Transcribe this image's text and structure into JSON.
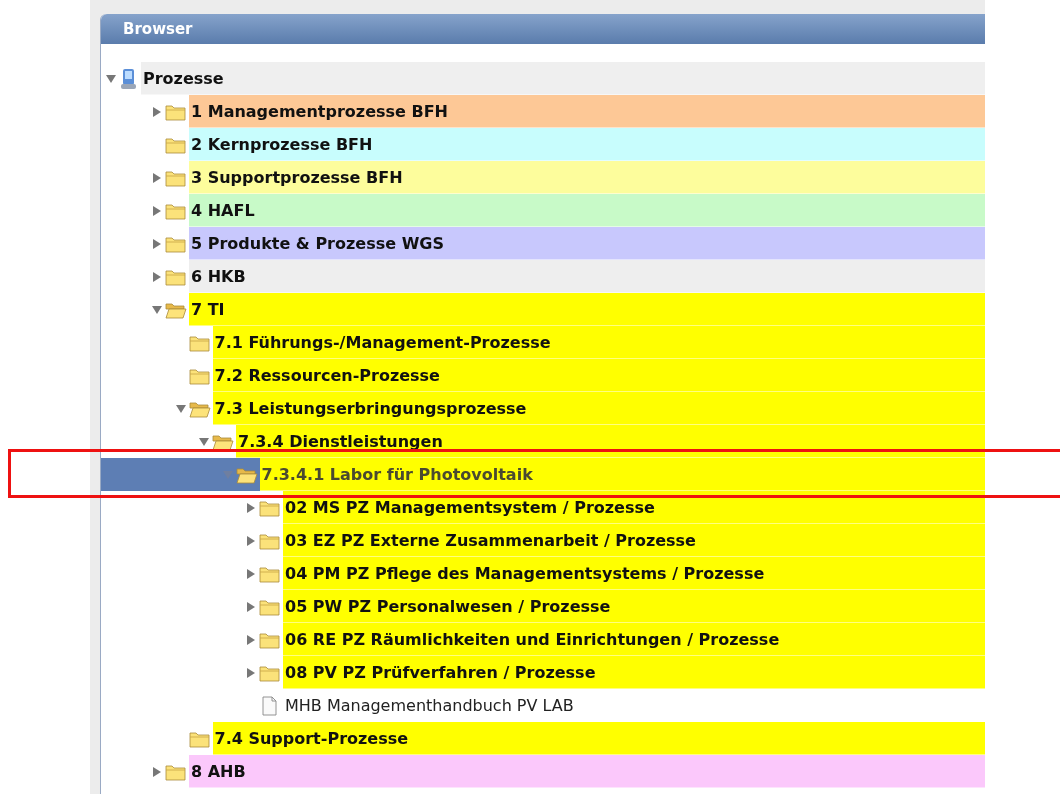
{
  "panel": {
    "title": "Browser"
  },
  "tree": [
    {
      "label": "Prozesse",
      "kind": "root",
      "expanded": true,
      "selected": false,
      "color": "#efefef",
      "children": [
        {
          "label": "1 Managementprozesse BFH",
          "kind": "folder",
          "expanded": false,
          "selected": false,
          "color": "#fdc896"
        },
        {
          "label": "2 Kernprozesse BFH",
          "kind": "folder",
          "selected": false,
          "color": "#c8fdfd"
        },
        {
          "label": "3 Supportprozesse BFH",
          "kind": "folder",
          "expanded": false,
          "selected": false,
          "color": "#fdfd9c"
        },
        {
          "label": "4 HAFL",
          "kind": "folder",
          "expanded": false,
          "selected": false,
          "color": "#c8fac8"
        },
        {
          "label": "5 Produkte & Prozesse WGS",
          "kind": "folder",
          "expanded": false,
          "selected": false,
          "color": "#c8c8fd"
        },
        {
          "label": "6 HKB",
          "kind": "folder",
          "expanded": false,
          "selected": false,
          "color": "#eeeeee"
        },
        {
          "label": "7 TI",
          "kind": "folder",
          "expanded": true,
          "selected": false,
          "color": "#ffff00",
          "children": [
            {
              "label": "7.1 Führungs-/Management-Prozesse",
              "kind": "folder",
              "selected": false,
              "color": "#ffff00"
            },
            {
              "label": "7.2 Ressourcen-Prozesse",
              "kind": "folder",
              "selected": false,
              "color": "#ffff00"
            },
            {
              "label": "7.3 Leistungserbringungsprozesse",
              "kind": "folder",
              "expanded": true,
              "selected": false,
              "color": "#ffff00",
              "children": [
                {
                  "label": "7.3.4 Dienstleistungen",
                  "kind": "folder",
                  "expanded": true,
                  "selected": false,
                  "color": "#ffff00",
                  "children": [
                    {
                      "label": "7.3.4.1 Labor für Photovoltaik",
                      "kind": "folder",
                      "expanded": true,
                      "selected": true,
                      "color": "#ffff00",
                      "children": [
                        {
                          "label": "02 MS PZ Managementsystem / Prozesse",
                          "kind": "folder",
                          "expanded": false,
                          "selected": false,
                          "color": "#ffff00"
                        },
                        {
                          "label": "03 EZ PZ Externe Zusammenarbeit / Prozesse",
                          "kind": "folder",
                          "expanded": false,
                          "selected": false,
                          "color": "#ffff00"
                        },
                        {
                          "label": "04 PM PZ Pflege des Managementsystems / Prozesse",
                          "kind": "folder",
                          "expanded": false,
                          "selected": false,
                          "color": "#ffff00"
                        },
                        {
                          "label": "05 PW PZ Personalwesen / Prozesse",
                          "kind": "folder",
                          "expanded": false,
                          "selected": false,
                          "color": "#ffff00"
                        },
                        {
                          "label": "06 RE PZ Räumlichkeiten und Einrichtungen / Prozesse",
                          "kind": "folder",
                          "expanded": false,
                          "selected": false,
                          "color": "#ffff00"
                        },
                        {
                          "label": "08 PV PZ Prüfverfahren / Prozesse",
                          "kind": "folder",
                          "expanded": false,
                          "selected": false,
                          "color": "#ffff00"
                        },
                        {
                          "label": "MHB Managementhandbuch PV LAB",
                          "kind": "file",
                          "selected": false
                        }
                      ]
                    }
                  ]
                }
              ]
            },
            {
              "label": "7.4 Support-Prozesse",
              "kind": "folder",
              "selected": false,
              "color": "#ffff00"
            }
          ]
        },
        {
          "label": "8 AHB",
          "kind": "folder",
          "expanded": false,
          "selected": false,
          "color": "#fbc8fb"
        }
      ]
    }
  ]
}
